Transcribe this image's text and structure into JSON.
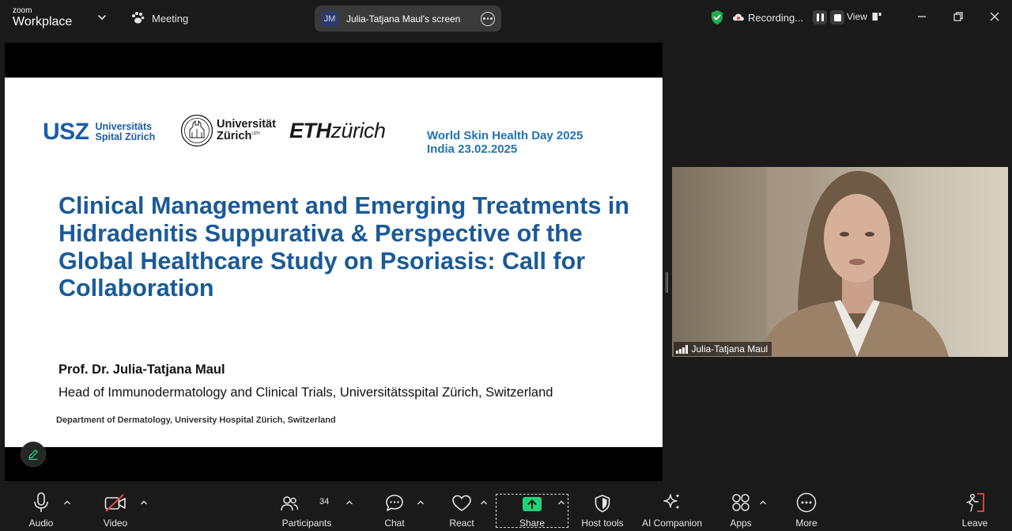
{
  "app": {
    "brand_small": "zoom",
    "brand_large": "Workplace"
  },
  "header": {
    "meeting_label": "Meeting",
    "share_initials": "JM",
    "share_label": "Julia-Tatjana Maul's screen",
    "recording_label": "Recording...",
    "view_label": "View"
  },
  "slide": {
    "usz_big": "USZ",
    "usz_line1": "Universitäts",
    "usz_line2": "Spital Zürich",
    "uzh_line1": "Universität",
    "uzh_line2": "Zürich",
    "uzh_sup": "UZH",
    "eth_bold": "ETH",
    "eth_light": "zürich",
    "event_line1": "World Skin Health Day 2025",
    "event_line2": "India 23.02.2025",
    "title": "Clinical Management and Emerging Treatments in Hidradenitis Suppurativa & Perspective of the Global Healthcare Study on Psoriasis: Call for Collaboration",
    "presenter_name": "Prof. Dr. Julia-Tatjana Maul",
    "presenter_role": "Head of Immunodermatology and Clinical Trials, Universitätsspital Zürich, Switzerland",
    "department": "Department of Dermatology, University Hospital Zürich, Switzerland"
  },
  "video": {
    "participant_name": "Julia-Tatjana Maul"
  },
  "toolbar": {
    "audio": "Audio",
    "video": "Video",
    "participants": "Participants",
    "participants_count": "34",
    "chat": "Chat",
    "react": "React",
    "share": "Share",
    "host_tools": "Host tools",
    "ai_companion": "AI Companion",
    "apps": "Apps",
    "more": "More",
    "leave": "Leave"
  },
  "colors": {
    "share_green": "#21d37a",
    "leave_red": "#e5484d",
    "shield_green": "#1fae4b",
    "slide_title_blue": "#1a5a98",
    "usz_blue": "#1b5cab",
    "event_blue": "#1f73b7"
  }
}
